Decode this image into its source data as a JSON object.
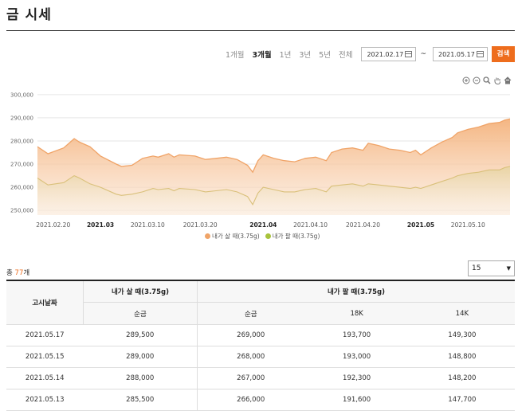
{
  "page": {
    "title": "금 시세"
  },
  "filters": {
    "periods": [
      {
        "label": "1개월",
        "active": false
      },
      {
        "label": "3개월",
        "active": true
      },
      {
        "label": "1년",
        "active": false
      },
      {
        "label": "3년",
        "active": false
      },
      {
        "label": "5년",
        "active": false
      },
      {
        "label": "전체",
        "active": false
      }
    ],
    "start_date": "2021.02.17",
    "separator": "~",
    "end_date": "2021.05.17",
    "search_label": "검색"
  },
  "chart_tools": [
    "zoom-in-icon",
    "zoom-out-icon",
    "magnifier-icon",
    "pan-hand-icon",
    "home-icon"
  ],
  "chart_data": {
    "type": "area",
    "title": "",
    "xlabel": "",
    "ylabel": "",
    "ylim": [
      248000,
      302000
    ],
    "y_ticks": [
      "300,000",
      "290,000",
      "280,000",
      "270,000",
      "260,000",
      "250,000"
    ],
    "y_tick_values": [
      300000,
      290000,
      280000,
      270000,
      260000,
      250000
    ],
    "grid": true,
    "legend_position": "bottom",
    "x_ticks": [
      {
        "label": "2021.02.20",
        "day": 3,
        "bold": false
      },
      {
        "label": "2021.03",
        "day": 12,
        "bold": true
      },
      {
        "label": "2021.03.10",
        "day": 21,
        "bold": false
      },
      {
        "label": "2021.03.20",
        "day": 31,
        "bold": false
      },
      {
        "label": "2021.04",
        "day": 43,
        "bold": true
      },
      {
        "label": "2021.04.10",
        "day": 52,
        "bold": false
      },
      {
        "label": "2021.04.20",
        "day": 62,
        "bold": false
      },
      {
        "label": "2021.05",
        "day": 73,
        "bold": true
      },
      {
        "label": "2021.05.10",
        "day": 82,
        "bold": false
      }
    ],
    "x_days": [
      0,
      2,
      5,
      7,
      8,
      10,
      12,
      15,
      16,
      18,
      20,
      22,
      23,
      25,
      26,
      27,
      30,
      32,
      34,
      36,
      38,
      40,
      41,
      42,
      43,
      45,
      47,
      49,
      51,
      53,
      55,
      56,
      58,
      60,
      62,
      63,
      65,
      67,
      69,
      71,
      72,
      73,
      75,
      77,
      79,
      80,
      82,
      84,
      86,
      88,
      89,
      90
    ],
    "series": [
      {
        "name": "내가 살 때(3.75g)",
        "color": "#f0a468",
        "values": [
          277500,
          274500,
          277000,
          281000,
          279500,
          277500,
          273500,
          270000,
          269000,
          269500,
          272500,
          273500,
          273000,
          274500,
          273000,
          274000,
          273500,
          272000,
          272500,
          273000,
          272000,
          269500,
          266500,
          271500,
          274000,
          272500,
          271500,
          271000,
          272500,
          273000,
          271500,
          275000,
          276500,
          277000,
          276000,
          279000,
          278000,
          276500,
          276000,
          275000,
          276000,
          274000,
          277000,
          279500,
          281500,
          283500,
          285000,
          286000,
          287500,
          288000,
          289000,
          289500
        ]
      },
      {
        "name": "내가 팔 때(3.75g)",
        "color": "#a8c33c",
        "values": [
          264000,
          261000,
          262000,
          265000,
          264000,
          261500,
          260000,
          257000,
          256500,
          257000,
          258000,
          259500,
          259000,
          259500,
          258500,
          259500,
          259000,
          258000,
          258500,
          259000,
          258000,
          256000,
          252500,
          257500,
          260000,
          259000,
          258000,
          258000,
          259000,
          259500,
          258000,
          260500,
          261000,
          261500,
          260500,
          261500,
          261000,
          260500,
          260000,
          259500,
          260000,
          259500,
          261000,
          262500,
          264000,
          265000,
          266000,
          266500,
          267500,
          267500,
          268500,
          269000
        ]
      }
    ]
  },
  "list": {
    "total_prefix": "총 ",
    "total_count": "77",
    "total_suffix": "개",
    "page_size": "15"
  },
  "table": {
    "h_date": "고시날짜",
    "h_buy": "내가 살 때(3.75g)",
    "h_sell": "내가 팔 때(3.75g)",
    "h_buy_pure": "순금",
    "h_sell_pure": "순금",
    "h_18k": "18K",
    "h_14k": "14K",
    "rows": [
      {
        "date": "2021.05.17",
        "buy": "289,500",
        "sell_pure": "269,000",
        "k18": "193,700",
        "k14": "149,300"
      },
      {
        "date": "2021.05.15",
        "buy": "289,000",
        "sell_pure": "268,000",
        "k18": "193,000",
        "k14": "148,800"
      },
      {
        "date": "2021.05.14",
        "buy": "288,000",
        "sell_pure": "267,000",
        "k18": "192,300",
        "k14": "148,200"
      },
      {
        "date": "2021.05.13",
        "buy": "285,500",
        "sell_pure": "266,000",
        "k18": "191,600",
        "k14": "147,700"
      }
    ]
  }
}
